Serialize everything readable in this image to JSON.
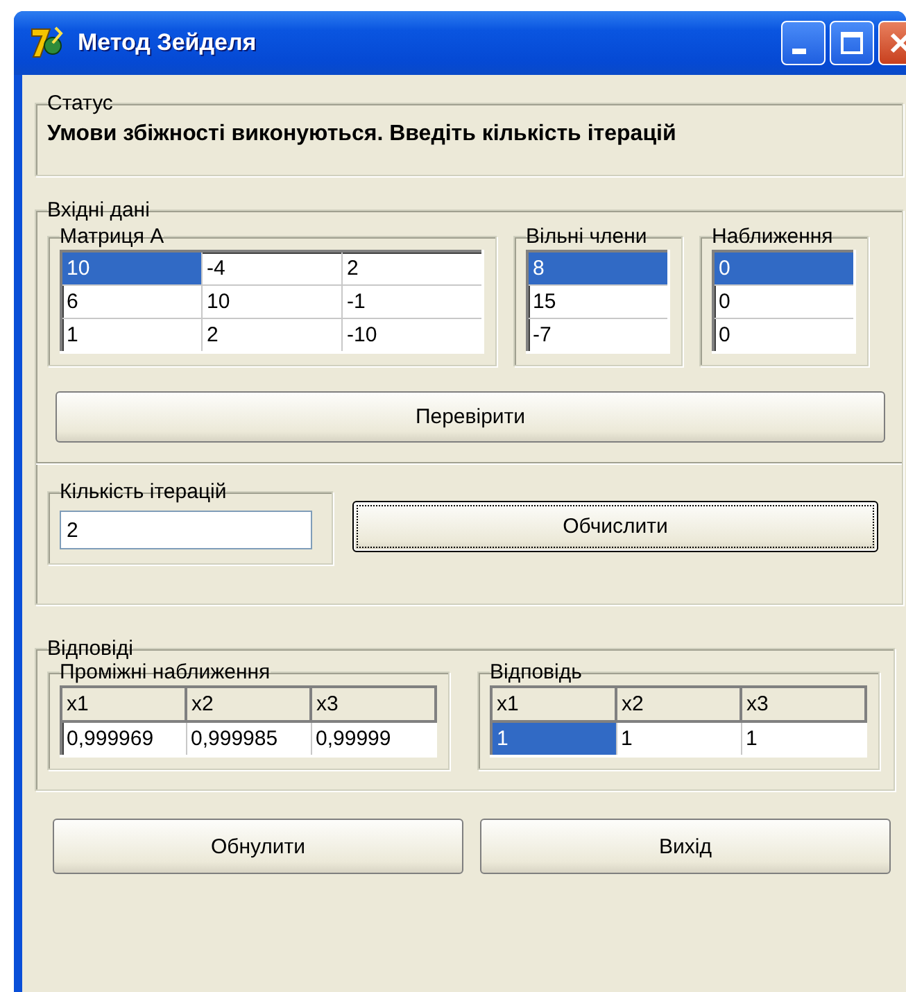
{
  "window": {
    "title": "Метод Зейделя"
  },
  "status": {
    "label": "Статус",
    "message": "Умови збіжності виконуються. Введіть кількість ітерацій"
  },
  "input": {
    "label": "Вхідні дані",
    "matrix": {
      "label": "Матриця А",
      "rows": [
        [
          {
            "text": "10",
            "selected": true
          },
          {
            "text": "-4",
            "selected": false
          },
          {
            "text": "2",
            "selected": false
          }
        ],
        [
          {
            "text": "6",
            "selected": false
          },
          {
            "text": "10",
            "selected": false
          },
          {
            "text": "-1",
            "selected": false
          }
        ],
        [
          {
            "text": "1",
            "selected": false
          },
          {
            "text": "2",
            "selected": false
          },
          {
            "text": "-10",
            "selected": false
          }
        ]
      ]
    },
    "free_terms": {
      "label": "Вільні члени",
      "rows": [
        [
          {
            "text": "8",
            "selected": true
          }
        ],
        [
          {
            "text": "15",
            "selected": false
          }
        ],
        [
          {
            "text": "-7",
            "selected": false
          }
        ]
      ]
    },
    "initial": {
      "label": "Наближення",
      "rows": [
        [
          {
            "text": "0",
            "selected": true
          }
        ],
        [
          {
            "text": "0",
            "selected": false
          }
        ],
        [
          {
            "text": "0",
            "selected": false
          }
        ]
      ]
    },
    "check_button": {
      "label": "Перевірити",
      "focused": false
    },
    "iterations": {
      "label": "Кількість ітерацій",
      "value": "2"
    },
    "compute_button": {
      "label": "Обчислити",
      "focused": true
    }
  },
  "answers": {
    "label": "Відповіді",
    "intermediate": {
      "label": "Проміжні наближення",
      "columns": [
        "x1",
        "x2",
        "x3"
      ],
      "rows": [
        [
          {
            "text": "0,999969",
            "selected": false
          },
          {
            "text": "0,999985",
            "selected": false
          },
          {
            "text": "0,99999",
            "selected": false
          }
        ]
      ]
    },
    "answer": {
      "label": "Відповідь",
      "columns": [
        "x1",
        "x2",
        "x3"
      ],
      "rows": [
        [
          {
            "text": "1",
            "selected": true
          },
          {
            "text": "1",
            "selected": false
          },
          {
            "text": "1",
            "selected": false
          }
        ]
      ]
    }
  },
  "buttons": [
    {
      "label": "Обнулити",
      "focused": false
    },
    {
      "label": "Вихід",
      "focused": false
    }
  ]
}
